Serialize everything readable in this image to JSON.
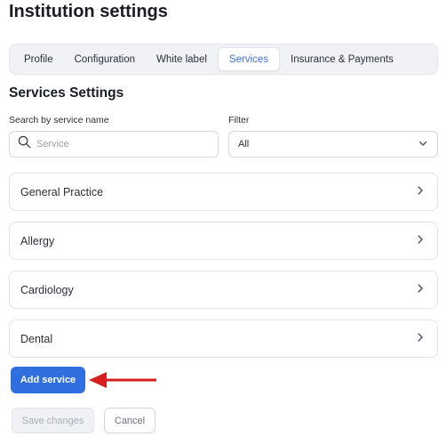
{
  "page": {
    "title": "Institution settings"
  },
  "tabs": [
    {
      "label": "Profile",
      "active": false
    },
    {
      "label": "Configuration",
      "active": false
    },
    {
      "label": "White label",
      "active": false
    },
    {
      "label": "Services",
      "active": true
    },
    {
      "label": "Insurance & Payments",
      "active": false
    }
  ],
  "section": {
    "title": "Services Settings"
  },
  "search": {
    "label": "Search by service name",
    "placeholder": "Service",
    "value": "",
    "icon": "search-icon"
  },
  "filter": {
    "label": "Filter",
    "selected": "All",
    "icon": "chevron-down-icon"
  },
  "services": [
    {
      "name": "General Practice"
    },
    {
      "name": "Allergy"
    },
    {
      "name": "Cardiology"
    },
    {
      "name": "Dental"
    }
  ],
  "actions": {
    "add_service_label": "Add service",
    "save_label": "Save changes",
    "cancel_label": "Cancel"
  },
  "colors": {
    "primary": "#2f6fe0",
    "active_tab_text": "#3f6fd8",
    "annotation_arrow": "#d61f1f"
  }
}
